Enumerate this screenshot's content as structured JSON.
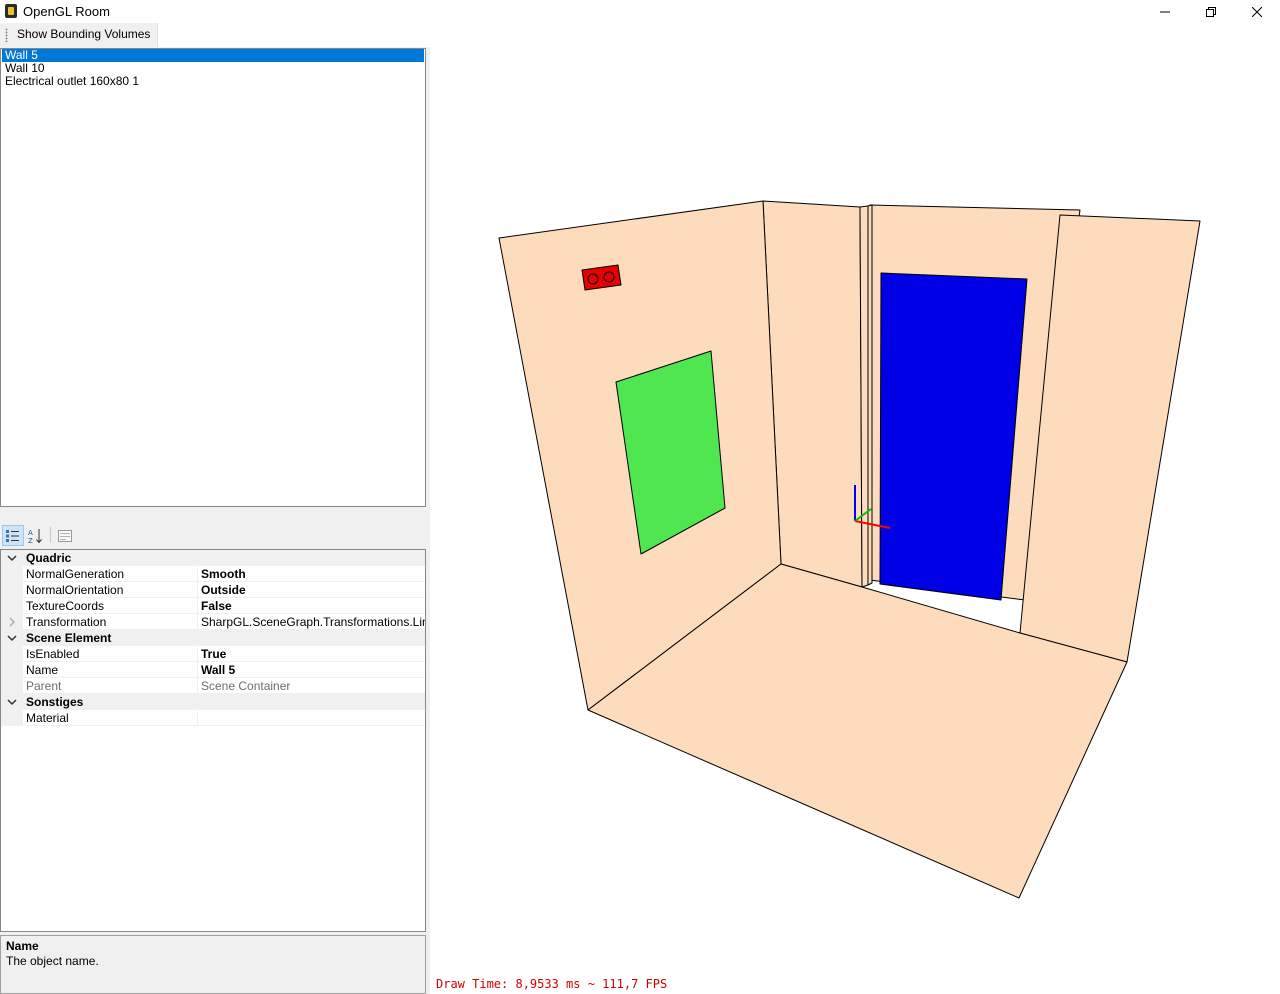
{
  "window": {
    "title": "OpenGL Room",
    "minimize_icon": "minimize-icon",
    "maximize_icon": "restore-icon",
    "close_icon": "close-icon"
  },
  "toolbar": {
    "show_bounding_volumes_label": "Show Bounding Volumes"
  },
  "scene_list": {
    "items": [
      {
        "label": "Wall 5",
        "selected": true
      },
      {
        "label": "Wall 10",
        "selected": false
      },
      {
        "label": "Electrical outlet 160x80 1",
        "selected": false
      }
    ]
  },
  "property_grid": {
    "categories": [
      {
        "name": "Quadric",
        "properties": [
          {
            "name": "NormalGeneration",
            "value": "Smooth"
          },
          {
            "name": "NormalOrientation",
            "value": "Outside"
          },
          {
            "name": "TextureCoords",
            "value": "False"
          },
          {
            "name": "Transformation",
            "value": "SharpGL.SceneGraph.Transformations.LinearTr"
          }
        ]
      },
      {
        "name": "Scene Element",
        "properties": [
          {
            "name": "IsEnabled",
            "value": "True"
          },
          {
            "name": "Name",
            "value": "Wall 5"
          },
          {
            "name": "Parent",
            "value": "Scene Container"
          }
        ]
      },
      {
        "name": "Sonstiges",
        "properties": [
          {
            "name": "Material",
            "value": ""
          }
        ]
      }
    ]
  },
  "description": {
    "title": "Name",
    "text": "The object name."
  },
  "viewport": {
    "status": "Draw Time: 8,9533 ms ~ 111,7 FPS",
    "colors": {
      "wall": "#fddbbd",
      "door": "#0000e6",
      "window": "#50e650",
      "outlet": "#e60000",
      "status_text": "#d00000"
    }
  }
}
